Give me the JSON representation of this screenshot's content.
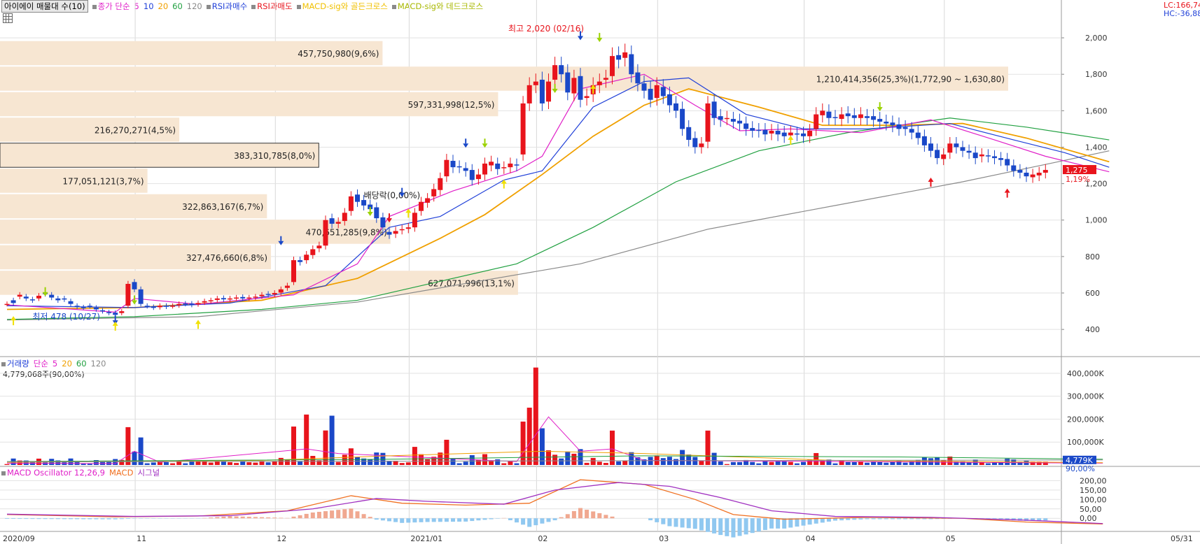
{
  "legend": {
    "price": {
      "title": "아이에이 매물대 수(10)",
      "ma_label": "종가 단순",
      "periods": [
        "5",
        "10",
        "20",
        "60",
        "120"
      ],
      "rsi_buy": "RSI과매수",
      "rsi_sell": "RSI과매도",
      "golden": "MACD-sig와 골든크로스",
      "dead": "MACD-sig와 데드크로스"
    },
    "volume": {
      "title": "거래량",
      "ma_label": "단순",
      "periods": [
        "5",
        "20",
        "60",
        "120"
      ],
      "readout": "4,779,068주(90,00%)"
    },
    "macd": {
      "title": "MACD Oscillator 12,26,9",
      "macd": "MACD",
      "signal": "시그널"
    }
  },
  "top_right": {
    "lc": "LC:166,74",
    "hc": "HC:-36,88"
  },
  "colors": {
    "up": "#e8141c",
    "down": "#1a48c8",
    "ma5": "#e020c8",
    "ma10": "#2040d8",
    "ma20": "#f0a000",
    "ma60": "#20a040",
    "ma120": "#8a8a8a",
    "profile": "#f7e6d2",
    "macd": "#f07020",
    "signal": "#a030c0",
    "osc_up": "#f0a890",
    "osc_down": "#90c8f0"
  },
  "chart_data": [
    {
      "type": "candlestick",
      "panel": "price",
      "ylim": [
        320,
        2100
      ],
      "y_ticks": [
        "2,000",
        "1,800",
        "1,600",
        "1,400",
        "1,200",
        "1,000",
        "800",
        "600",
        "400"
      ],
      "current_price": "1,275",
      "current_change": "1,19%",
      "annotations": {
        "high": "최고 2,020 (02/16)",
        "low": "최저 478 (10/27)",
        "dividend": "배당락(0,00%)"
      },
      "close": [
        540,
        545,
        590,
        570,
        560,
        585,
        595,
        575,
        560,
        565,
        540,
        525,
        520,
        528,
        510,
        500,
        490,
        480,
        500,
        650,
        620,
        540,
        528,
        520,
        530,
        525,
        530,
        540,
        540,
        535,
        545,
        555,
        560,
        570,
        565,
        570,
        575,
        570,
        575,
        580,
        590,
        590,
        600,
        620,
        640,
        780,
        770,
        810,
        840,
        860,
        1000,
        980,
        990,
        1040,
        1130,
        1100,
        1080,
        1060,
        1010,
        960,
        920,
        940,
        950,
        960,
        1040,
        1100,
        1120,
        1170,
        1230,
        1330,
        1290,
        1290,
        1270,
        1220,
        1250,
        1310,
        1320,
        1280,
        1290,
        1310,
        1300,
        1640,
        1740,
        1760,
        1640,
        1760,
        1850,
        1800,
        1700,
        1780,
        1660,
        1680,
        1740,
        1760,
        1780,
        1900,
        1880,
        1920,
        1800,
        1750,
        1710,
        1660,
        1740,
        1680,
        1630,
        1600,
        1500,
        1440,
        1400,
        1420,
        1640,
        1560,
        1550,
        1560,
        1540,
        1530,
        1500,
        1490,
        1490,
        1470,
        1490,
        1470,
        1460,
        1480,
        1470,
        1460,
        1490,
        1580,
        1600,
        1560,
        1560,
        1580,
        1570,
        1560,
        1580,
        1560,
        1550,
        1540,
        1530,
        1520,
        1500,
        1500,
        1480,
        1450,
        1410,
        1380,
        1340,
        1360,
        1420,
        1400,
        1380,
        1370,
        1340,
        1360,
        1350,
        1340,
        1330,
        1300,
        1270,
        1260,
        1240,
        1250,
        1260,
        1275
      ],
      "open": [
        540,
        560,
        580,
        580,
        565,
        570,
        600,
        590,
        570,
        570,
        555,
        530,
        522,
        530,
        520,
        505,
        495,
        492,
        490,
        530,
        660,
        620,
        530,
        524,
        522,
        530,
        528,
        532,
        542,
        542,
        538,
        548,
        556,
        562,
        572,
        565,
        572,
        578,
        570,
        576,
        582,
        595,
        592,
        602,
        628,
        660,
        780,
        780,
        808,
        845,
        860,
        1010,
        980,
        995,
        1050,
        1140,
        1110,
        1085,
        1070,
        1015,
        935,
        925,
        945,
        952,
        960,
        1050,
        1095,
        1130,
        1165,
        1240,
        1325,
        1295,
        1285,
        1275,
        1225,
        1250,
        1300,
        1310,
        1285,
        1290,
        1305,
        1360,
        1640,
        1740,
        1770,
        1650,
        1770,
        1850,
        1810,
        1695,
        1790,
        1670,
        1690,
        1740,
        1770,
        1790,
        1905,
        1890,
        1910,
        1810,
        1750,
        1720,
        1670,
        1730,
        1690,
        1640,
        1610,
        1510,
        1450,
        1400,
        1430,
        1650,
        1570,
        1560,
        1555,
        1545,
        1530,
        1505,
        1495,
        1495,
        1475,
        1490,
        1480,
        1465,
        1475,
        1475,
        1460,
        1500,
        1575,
        1595,
        1565,
        1555,
        1585,
        1575,
        1560,
        1570,
        1570,
        1555,
        1540,
        1535,
        1525,
        1510,
        1500,
        1480,
        1460,
        1420,
        1385,
        1335,
        1370,
        1420,
        1400,
        1380,
        1370,
        1350,
        1355,
        1350,
        1340,
        1335,
        1300,
        1275,
        1260,
        1235,
        1245,
        1260
      ],
      "ma_lines": {
        "ma5": [
          [
            0,
            535
          ],
          [
            17,
            495
          ],
          [
            20,
            570
          ],
          [
            30,
            538
          ],
          [
            45,
            590
          ],
          [
            55,
            760
          ],
          [
            60,
            1020
          ],
          [
            70,
            1160
          ],
          [
            80,
            1270
          ],
          [
            84,
            1350
          ],
          [
            90,
            1720
          ],
          [
            100,
            1800
          ],
          [
            108,
            1630
          ],
          [
            115,
            1490
          ],
          [
            123,
            1500
          ],
          [
            134,
            1480
          ],
          [
            145,
            1550
          ],
          [
            155,
            1440
          ],
          [
            163,
            1350
          ],
          [
            173,
            1265
          ]
        ],
        "ma10": [
          [
            0,
            530
          ],
          [
            20,
            520
          ],
          [
            35,
            545
          ],
          [
            50,
            640
          ],
          [
            60,
            960
          ],
          [
            68,
            1020
          ],
          [
            78,
            1220
          ],
          [
            84,
            1270
          ],
          [
            92,
            1620
          ],
          [
            100,
            1760
          ],
          [
            107,
            1780
          ],
          [
            116,
            1580
          ],
          [
            125,
            1500
          ],
          [
            135,
            1500
          ],
          [
            148,
            1530
          ],
          [
            158,
            1440
          ],
          [
            166,
            1370
          ],
          [
            173,
            1290
          ]
        ],
        "ma20": [
          [
            0,
            510
          ],
          [
            20,
            520
          ],
          [
            40,
            560
          ],
          [
            55,
            680
          ],
          [
            68,
            900
          ],
          [
            75,
            1030
          ],
          [
            84,
            1250
          ],
          [
            92,
            1460
          ],
          [
            100,
            1630
          ],
          [
            107,
            1720
          ],
          [
            118,
            1620
          ],
          [
            128,
            1520
          ],
          [
            140,
            1520
          ],
          [
            150,
            1530
          ],
          [
            160,
            1450
          ],
          [
            173,
            1320
          ]
        ],
        "ma60": [
          [
            0,
            455
          ],
          [
            20,
            470
          ],
          [
            40,
            510
          ],
          [
            55,
            560
          ],
          [
            65,
            640
          ],
          [
            80,
            760
          ],
          [
            92,
            960
          ],
          [
            105,
            1210
          ],
          [
            118,
            1380
          ],
          [
            132,
            1480
          ],
          [
            148,
            1560
          ],
          [
            160,
            1510
          ],
          [
            173,
            1440
          ]
        ],
        "ma120": [
          [
            0,
            452
          ],
          [
            30,
            470
          ],
          [
            55,
            550
          ],
          [
            70,
            640
          ],
          [
            90,
            760
          ],
          [
            110,
            950
          ],
          [
            130,
            1080
          ],
          [
            150,
            1210
          ],
          [
            165,
            1320
          ],
          [
            173,
            1380
          ]
        ]
      }
    },
    {
      "type": "bar",
      "panel": "volume",
      "ylim": [
        0,
        430000
      ],
      "y_ticks": [
        "400,000K",
        "300,000K",
        "200,000K",
        "100,000K"
      ],
      "current": "4,779K",
      "current_pct": "90,00%"
    },
    {
      "type": "line",
      "panel": "macd",
      "ylim": [
        -40,
        220
      ],
      "y_ticks": [
        "200,00",
        "150,00",
        "100,00",
        "50,00",
        "0,00"
      ]
    }
  ],
  "x_labels": [
    "2020/09",
    "11",
    "12",
    "2021/01",
    "02",
    "03",
    "04",
    "05",
    "05/31"
  ],
  "volume_profile": [
    {
      "label": "627,071,996(13,1%)",
      "width": 0.13
    },
    {
      "label": "327,476,660(6,8%)",
      "width": 0.068
    },
    {
      "label": "470,651,285(9,8%)",
      "width": 0.098
    },
    {
      "label": "322,863,167(6,7%)",
      "width": 0.067
    },
    {
      "label": "177,051,121(3,7%)",
      "width": 0.037
    },
    {
      "label": "383,310,785(8,0%)",
      "width": 0.08
    },
    {
      "label": "216,270,271(4,5%)",
      "width": 0.045
    },
    {
      "label": "597,331,998(12,5%)",
      "width": 0.125
    },
    {
      "label": "1,210,414,356(25,3%)(1,772,90 ~ 1,630,80)",
      "width": 0.253
    },
    {
      "label": "457,750,980(9,6%)",
      "width": 0.096
    }
  ]
}
